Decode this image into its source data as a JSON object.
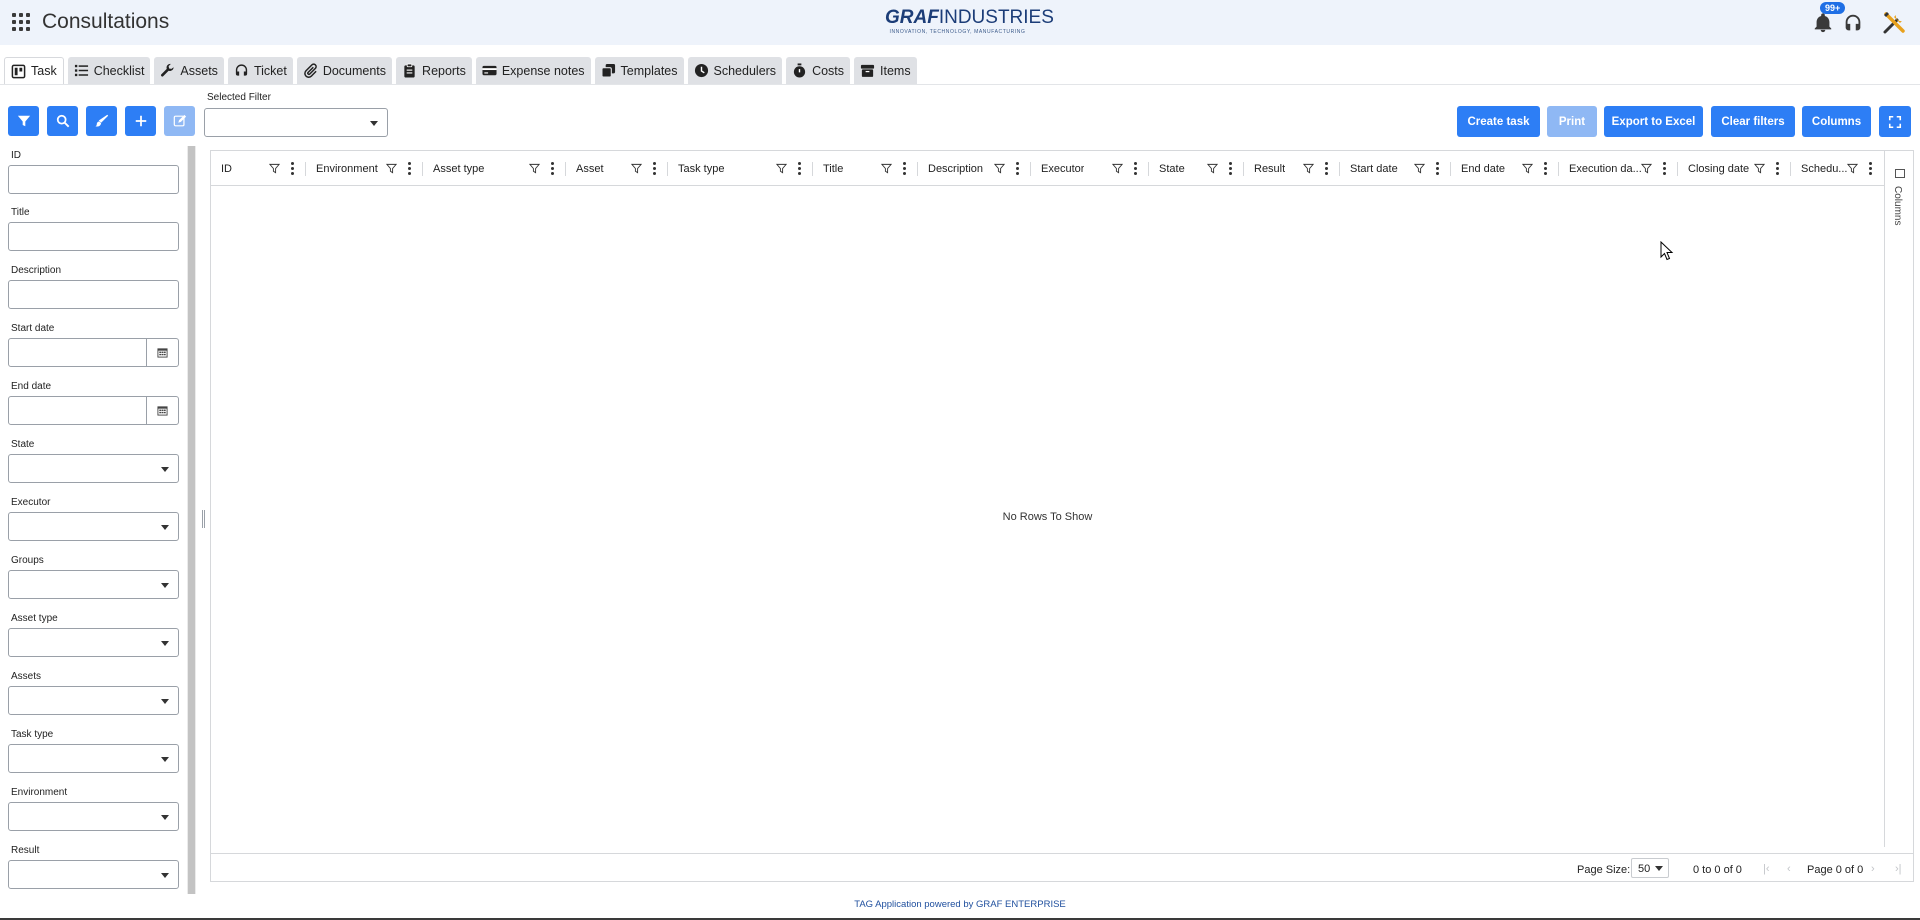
{
  "header": {
    "title": "Consultations",
    "logo_bold": "GRAF",
    "logo_light": "INDUSTRIES",
    "logo_tagline": "INNOVATION, TECHNOLOGY, MANUFACTURING",
    "notifications_badge": "99+"
  },
  "tabs": [
    {
      "label": "Task",
      "icon": "board-icon",
      "active": true
    },
    {
      "label": "Checklist",
      "icon": "list-icon"
    },
    {
      "label": "Assets",
      "icon": "wrench-icon"
    },
    {
      "label": "Ticket",
      "icon": "headset-icon"
    },
    {
      "label": "Documents",
      "icon": "paperclip-icon"
    },
    {
      "label": "Reports",
      "icon": "clipboard-icon"
    },
    {
      "label": "Expense notes",
      "icon": "credit-card-icon"
    },
    {
      "label": "Templates",
      "icon": "copy-icon"
    },
    {
      "label": "Schedulers",
      "icon": "clock-icon"
    },
    {
      "label": "Costs",
      "icon": "stopwatch-icon"
    },
    {
      "label": "Items",
      "icon": "box-icon"
    }
  ],
  "toolbar": {
    "selected_filter_label": "Selected Filter",
    "selected_filter_value": "",
    "create_task": "Create task",
    "print": "Print",
    "export_excel": "Export to Excel",
    "clear_filters": "Clear filters",
    "columns": "Columns"
  },
  "filters": {
    "id": "ID",
    "title": "Title",
    "description": "Description",
    "start_date": "Start date",
    "end_date": "End date",
    "state": "State",
    "executor": "Executor",
    "groups": "Groups",
    "asset_type": "Asset type",
    "assets": "Assets",
    "task_type": "Task type",
    "environment": "Environment",
    "result": "Result"
  },
  "grid": {
    "columns": [
      "ID",
      "Environment",
      "Asset type",
      "Asset",
      "Task type",
      "Title",
      "Description",
      "Executor",
      "State",
      "Result",
      "Start date",
      "End date",
      "Execution da...",
      "Closing date",
      "Schedu..."
    ],
    "empty_message": "No Rows To Show",
    "side_panel_label": "Columns",
    "page_size_label": "Page Size:",
    "page_size": "50",
    "range_text": "0 to 0 of 0",
    "page_text": "Page 0 of 0"
  },
  "footer": {
    "text": "TAG Application powered by GRAF ENTERPRISE"
  }
}
